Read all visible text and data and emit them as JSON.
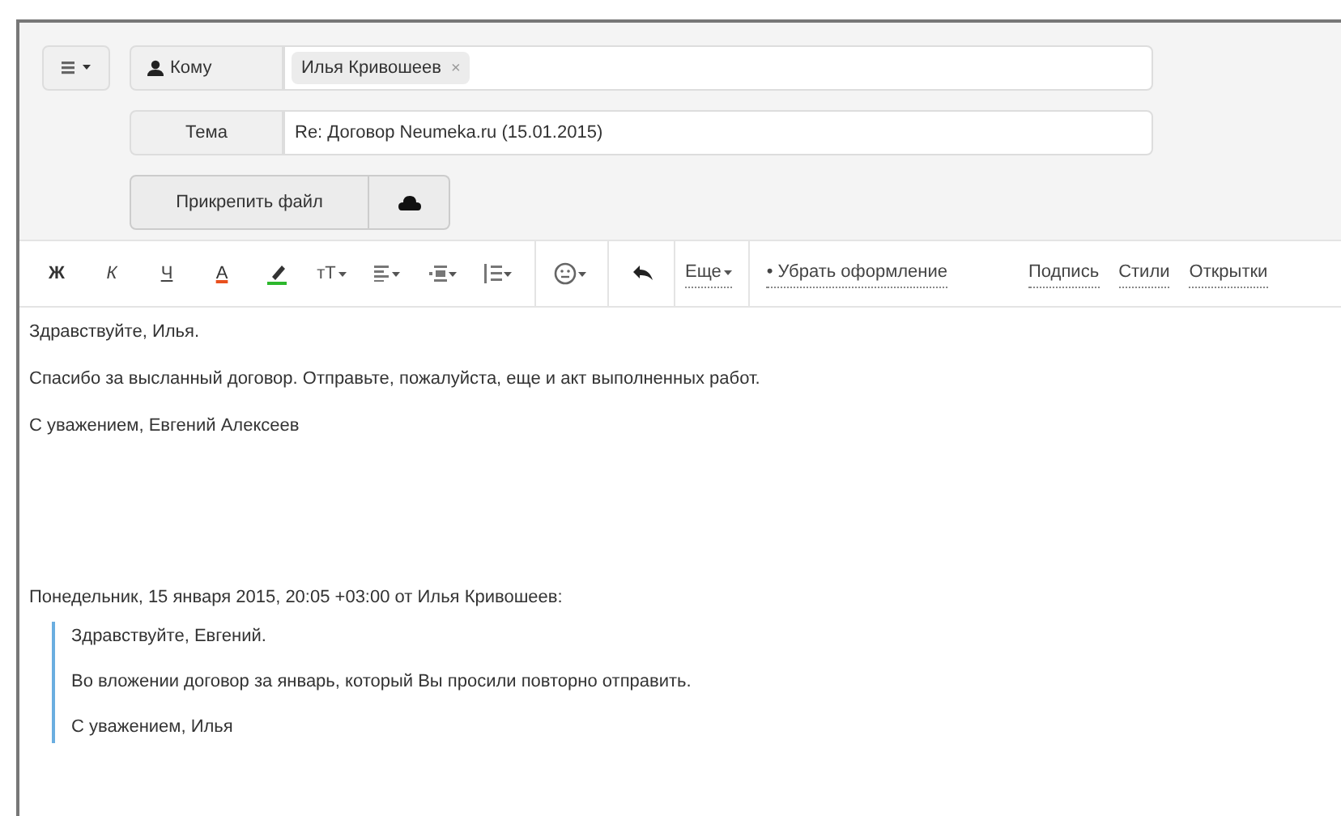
{
  "compose": {
    "to_label": "Кому",
    "recipients": [
      {
        "name": "Илья Кривошеев",
        "remove": "×"
      }
    ],
    "subject_label": "Тема",
    "subject": "Re: Договор Neumeka.ru (15.01.2015)",
    "attach_button": "Прикрепить файл"
  },
  "toolbar": {
    "buttons": [
      {
        "kind": "bold",
        "label": "Ж"
      },
      {
        "kind": "italic",
        "label": "К"
      },
      {
        "kind": "underline",
        "label": "Ч"
      },
      {
        "kind": "text_color",
        "label": "A"
      },
      {
        "kind": "highlight"
      },
      {
        "kind": "font_size",
        "label": "тT"
      },
      {
        "kind": "align"
      },
      {
        "kind": "indent"
      },
      {
        "kind": "list"
      },
      {
        "kind": "emoji"
      },
      {
        "kind": "undo"
      }
    ],
    "more": "Еще",
    "clear_formatting": "• Убрать оформление",
    "links": [
      "Подпись",
      "Стили",
      "Открытки"
    ]
  },
  "body": {
    "lines": [
      "Здравствуйте, Илья.",
      "Спасибо за высланный договор. Отправьте, пожалуйста, еще и акт выполненных работ.",
      "С уважением, Евгений Алексеев"
    ],
    "quote_header": "Понедельник, 15 января 2015, 20:05 +03:00 от Илья Кривошеев:",
    "quote": [
      "Здравствуйте, Евгений.",
      "Во вложении договор за январь, который Вы просили повторно отправить.",
      "С уважением, Илья"
    ]
  }
}
